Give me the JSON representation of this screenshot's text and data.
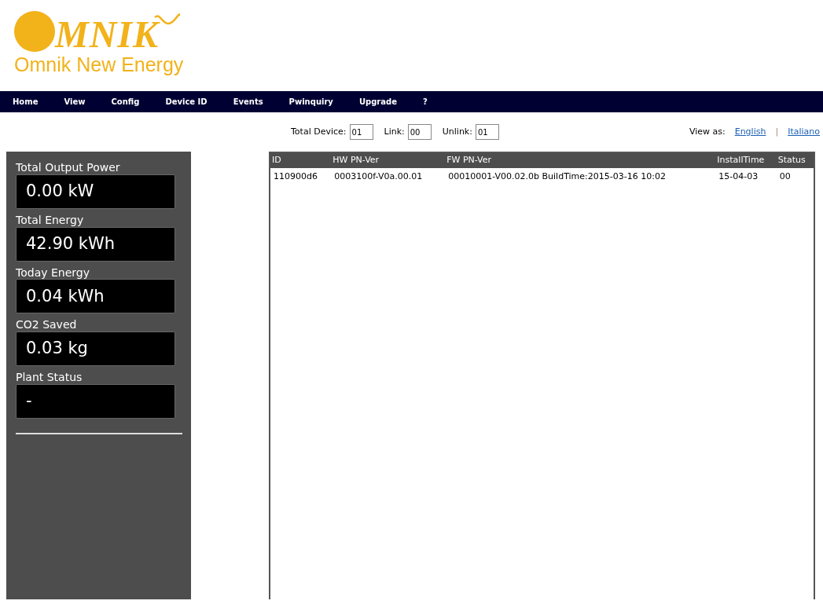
{
  "logo": {
    "mark": "MNIK",
    "subtitle": "Omnik New Energy"
  },
  "nav": [
    "Home",
    "View",
    "Config",
    "Device ID",
    "Events",
    "Pwinquiry",
    "Upgrade",
    "?"
  ],
  "counters": [
    {
      "label": "Total Device:",
      "value": "01"
    },
    {
      "label": "Link:",
      "value": "00"
    },
    {
      "label": "Unlink:",
      "value": "01"
    }
  ],
  "view_as": {
    "label": "View as:",
    "languages": [
      "English",
      "Italiano"
    ],
    "separator": "|"
  },
  "summary": [
    {
      "label": "Total Output Power",
      "value": "0.00 kW"
    },
    {
      "label": "Total Energy",
      "value": "42.90 kWh"
    },
    {
      "label": "Today Energy",
      "value": "0.04 kWh"
    },
    {
      "label": "CO2 Saved",
      "value": "0.03 kg"
    },
    {
      "label": "Plant Status",
      "value": "-"
    }
  ],
  "table": {
    "columns": [
      "ID",
      "HW PN-Ver",
      "FW PN-Ver",
      "InstallTime",
      "Status"
    ],
    "rows": [
      [
        "110900d6",
        "0003100f-V0a.00.01",
        "00010001-V00.02.0b BuildTime:2015-03-16 10:02",
        "15-04-03",
        "00"
      ]
    ]
  }
}
